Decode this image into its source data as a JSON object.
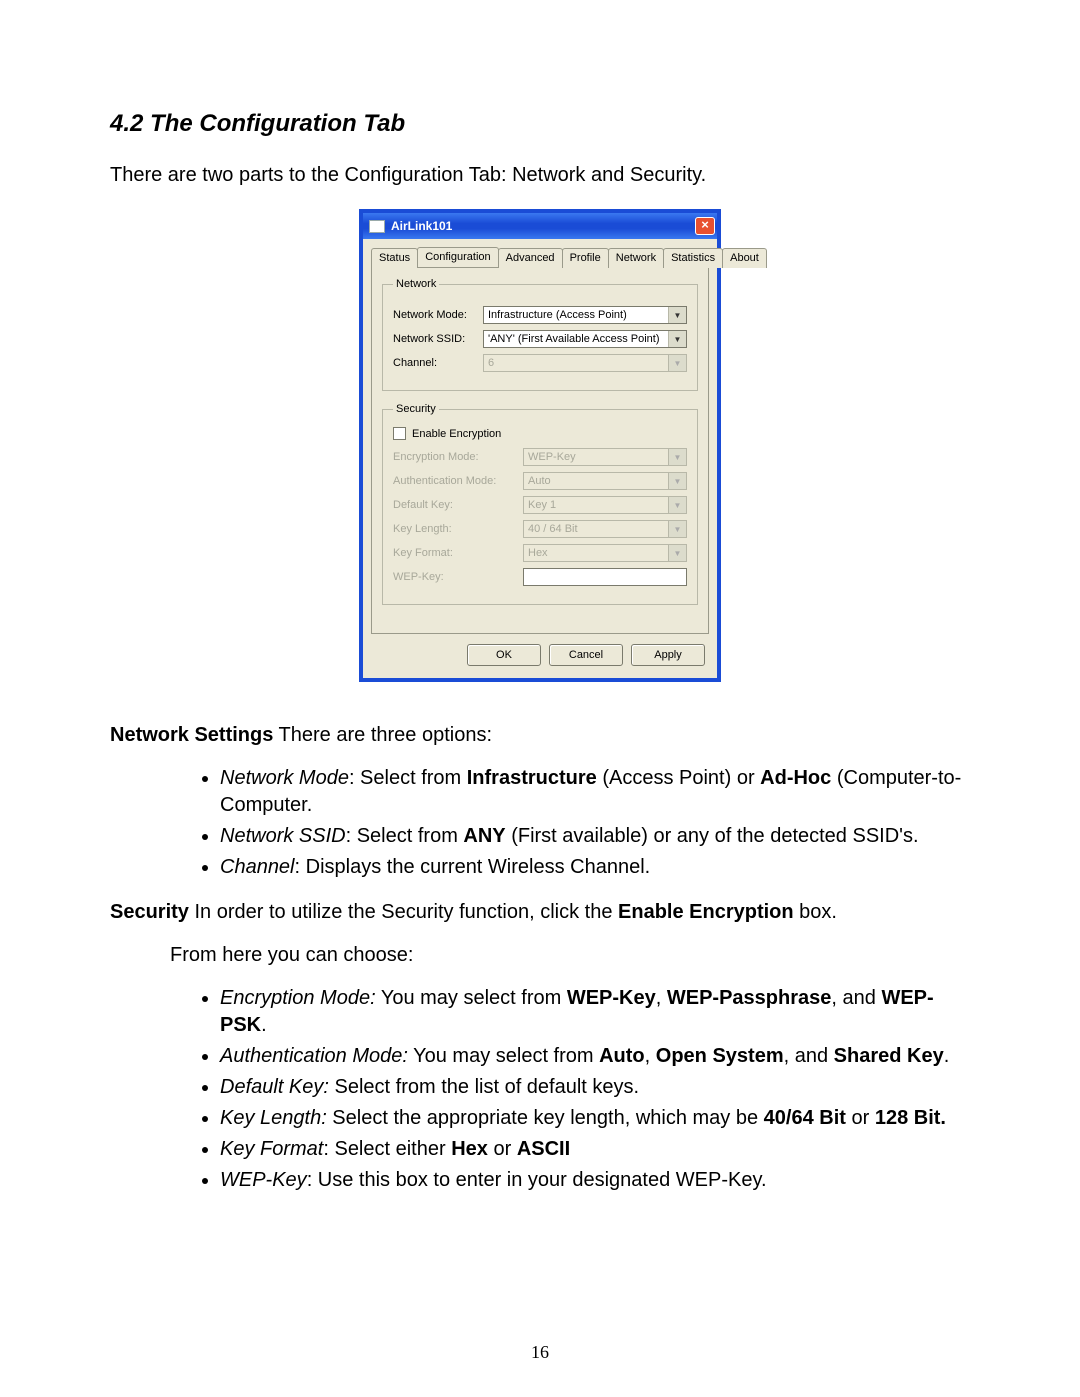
{
  "doc": {
    "heading": "4.2 The Configuration Tab",
    "intro": "There are two parts to the Configuration Tab: Network and Security.",
    "network_heading": "Network Settings",
    "network_after": " There are three options:",
    "net_b1_label": "Network Mode",
    "net_b1_text": ": Select from ",
    "net_b1_bold1": "Infrastructure",
    "net_b1_mid1": " (Access Point) or ",
    "net_b1_bold2": "Ad-Hoc",
    "net_b1_mid2": " (Computer-to-Computer.",
    "net_b2_label": "Network SSID",
    "net_b2_text": ": Select from ",
    "net_b2_bold1": "ANY",
    "net_b2_mid1": " (First available) or any of the detected SSID's.",
    "net_b3_label": "Channel",
    "net_b3_text": ": Displays the current Wireless Channel.",
    "security_heading": "Security",
    "security_after": " In order to utilize the Security function, click the ",
    "security_bold": "Enable Encryption",
    "security_after2": " box.",
    "from_here": "From here you can choose:",
    "sec_b1_label": "Encryption Mode:",
    "sec_b1_text": " You may select from ",
    "sec_b1_bold1": "WEP-Key",
    "sec_b1_sep1": ", ",
    "sec_b1_bold2": "WEP-Passphrase",
    "sec_b1_sep2": ", and ",
    "sec_b1_bold3": "WEP-PSK",
    "sec_b1_end": ".",
    "sec_b2_label": "Authentication Mode:",
    "sec_b2_text": "  You may select from ",
    "sec_b2_bold1": "Auto",
    "sec_b2_sep1": ", ",
    "sec_b2_bold2": "Open System",
    "sec_b2_sep2": ", and ",
    "sec_b2_bold3": "Shared Key",
    "sec_b2_end": ".",
    "sec_b3_label": "Default Key:",
    "sec_b3_text": " Select from the list of default keys.",
    "sec_b4_label": "Key Length:",
    "sec_b4_text": " Select the appropriate key length, which may be ",
    "sec_b4_bold1": "40/64 Bit",
    "sec_b4_mid": " or ",
    "sec_b4_bold2": "128 Bit.",
    "sec_b5_label": "Key Format",
    "sec_b5_text": ": Select either ",
    "sec_b5_bold1": "Hex",
    "sec_b5_mid": " or ",
    "sec_b5_bold2": "ASCII",
    "sec_b6_label": "WEP-Key",
    "sec_b6_text": ": Use this box to enter in your designated WEP-Key.",
    "page_number": "16"
  },
  "dialog": {
    "title": "AirLink101",
    "close": "×",
    "tabs": {
      "0": "Status",
      "1": "Configuration",
      "2": "Advanced",
      "3": "Profile",
      "4": "Network",
      "5": "Statistics",
      "6": "About"
    },
    "network": {
      "legend": "Network",
      "mode_label": "Network Mode:",
      "mode_value": "Infrastructure (Access Point)",
      "ssid_label": "Network SSID:",
      "ssid_value": "'ANY' (First Available Access Point)",
      "channel_label": "Channel:",
      "channel_value": "6"
    },
    "security": {
      "legend": "Security",
      "enable_label": "Enable Encryption",
      "enc_label": "Encryption Mode:",
      "enc_value": "WEP-Key",
      "auth_label": "Authentication Mode:",
      "auth_value": "Auto",
      "defkey_label": "Default Key:",
      "defkey_value": "Key 1",
      "keylen_label": "Key Length:",
      "keylen_value": "40 / 64 Bit",
      "keyfmt_label": "Key Format:",
      "keyfmt_value": "Hex",
      "wepkey_label": "WEP-Key:",
      "wepkey_value": ""
    },
    "buttons": {
      "ok": "OK",
      "cancel": "Cancel",
      "apply": "Apply"
    }
  }
}
